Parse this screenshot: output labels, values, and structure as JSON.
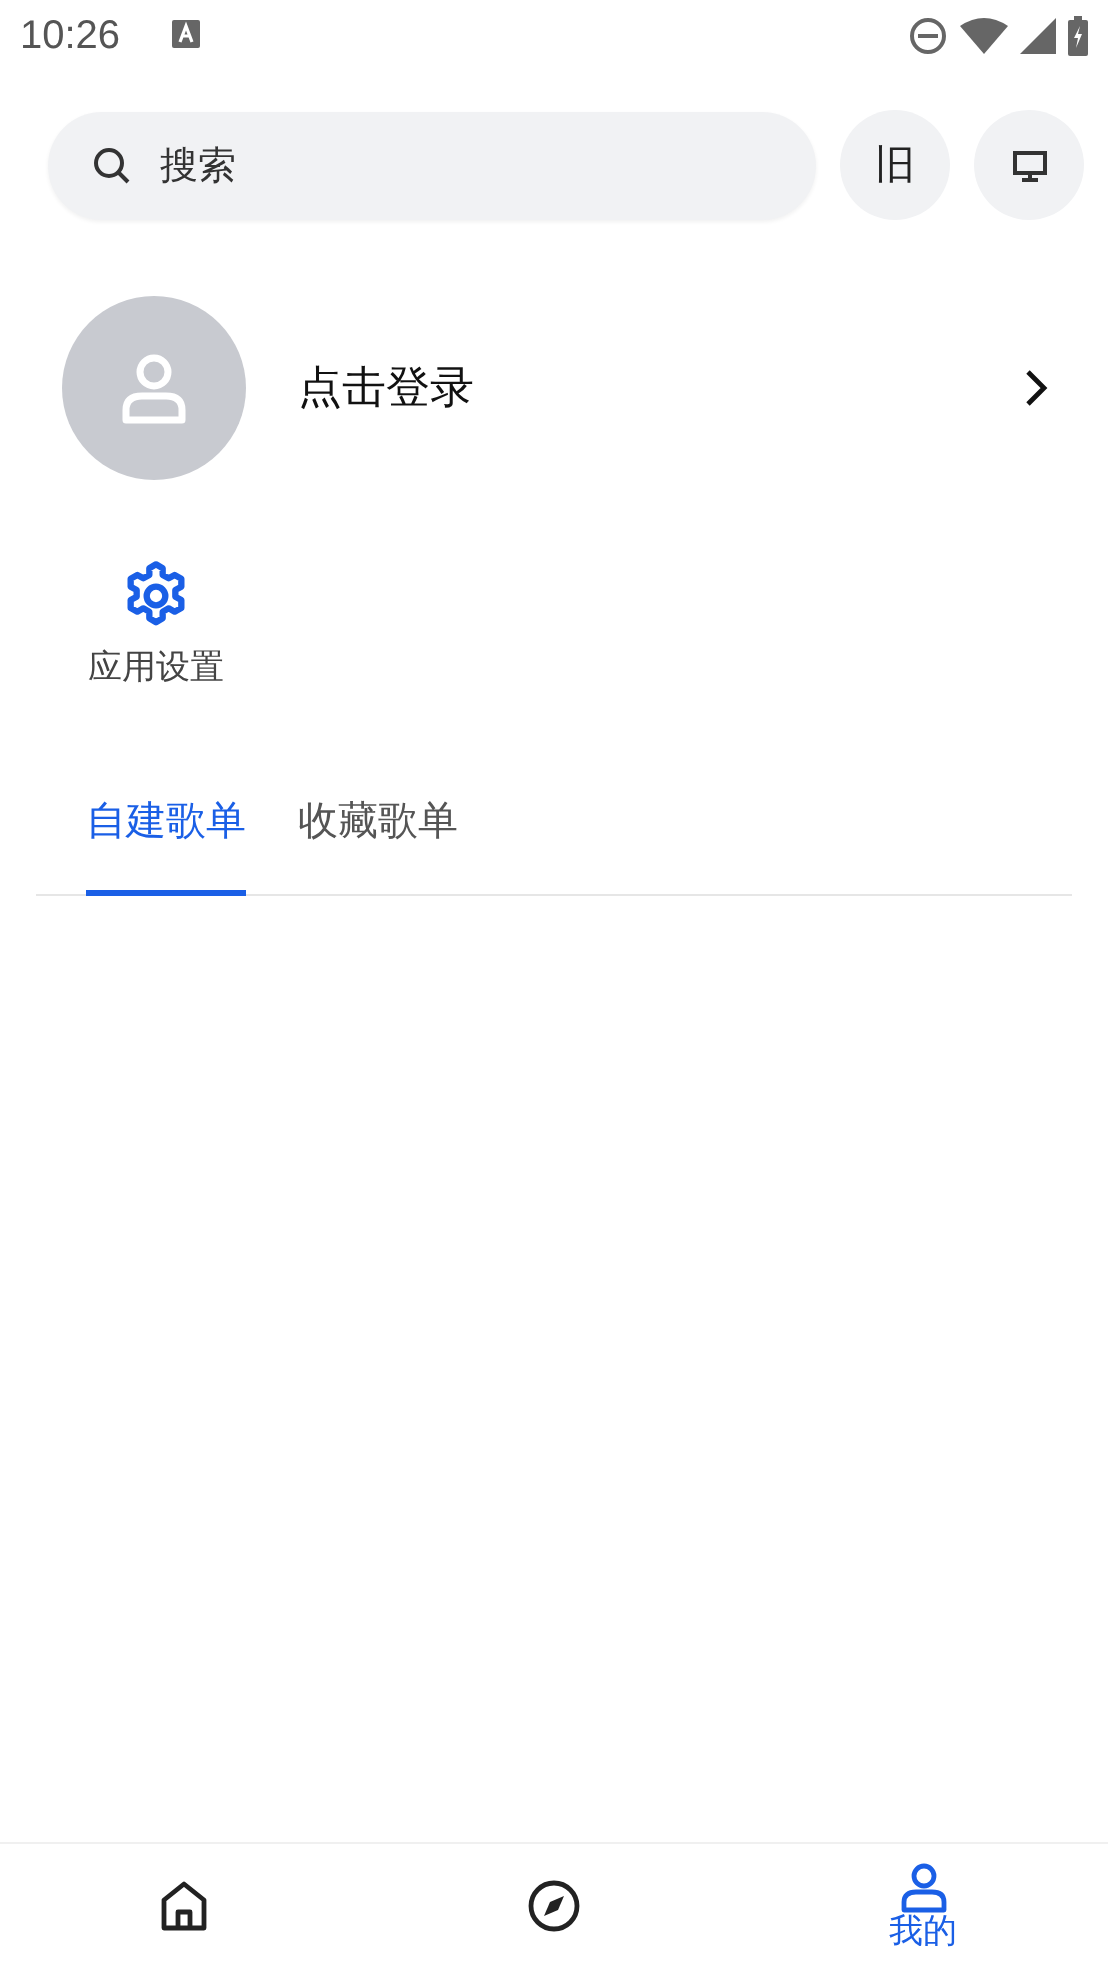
{
  "status_bar": {
    "time": "10:26"
  },
  "search": {
    "placeholder": "搜索"
  },
  "header_buttons": [
    {
      "kind": "text",
      "label": "旧"
    },
    {
      "kind": "monitor"
    }
  ],
  "profile": {
    "name": "点击登录"
  },
  "shortcuts": [
    {
      "label": "应用设置"
    }
  ],
  "tabs": [
    {
      "label": "自建歌单",
      "selected": true
    },
    {
      "label": "收藏歌单",
      "selected": false
    }
  ],
  "bottom_nav": [
    {
      "kind": "home",
      "selected": false
    },
    {
      "kind": "explore",
      "selected": false
    },
    {
      "kind": "profile",
      "label": "我的",
      "selected": true
    }
  ]
}
